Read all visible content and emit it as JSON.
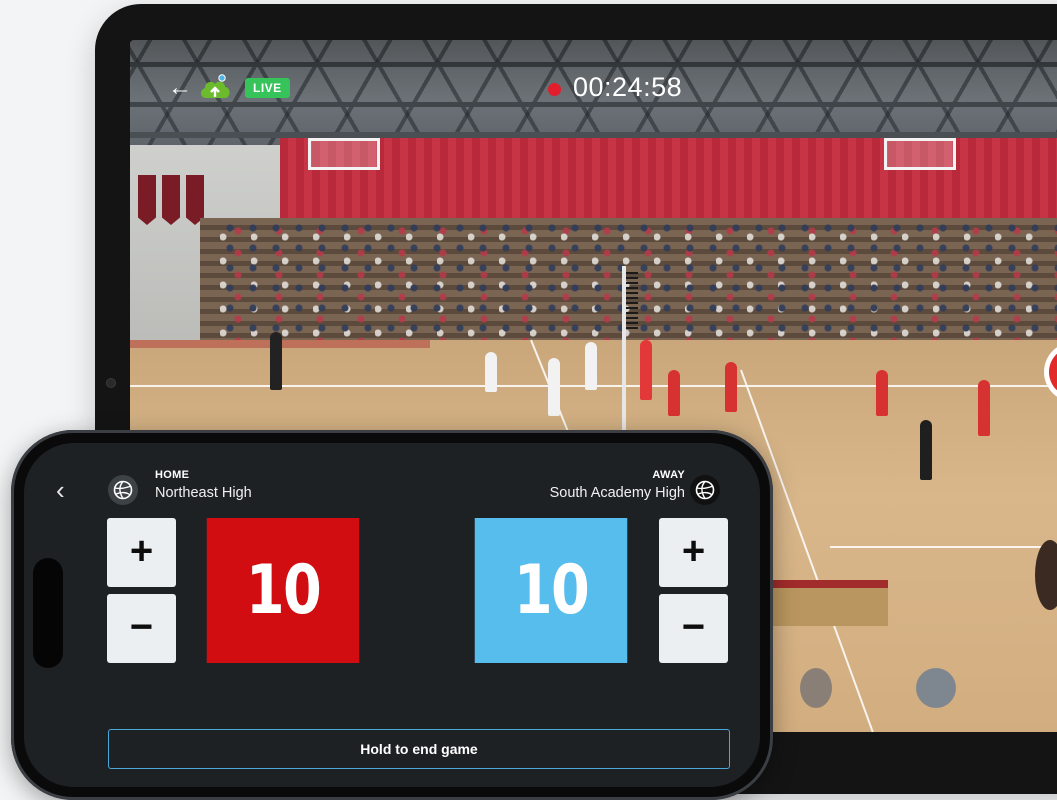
{
  "tablet": {
    "status": {
      "live_label": "LIVE",
      "timer": "00:24:58"
    },
    "icons": [
      "back-arrow-icon",
      "cloud-upload-icon",
      "recording-dot-icon",
      "record-button-icon"
    ]
  },
  "phone": {
    "home": {
      "tag": "HOME",
      "name": "Northeast High",
      "score": "10",
      "color": "#d20d12"
    },
    "away": {
      "tag": "AWAY",
      "name": "South Academy High",
      "score": "10",
      "color": "#57bdec"
    },
    "controls": {
      "plus_label": "+",
      "minus_label": "−",
      "end_label": "Hold to end game"
    }
  }
}
